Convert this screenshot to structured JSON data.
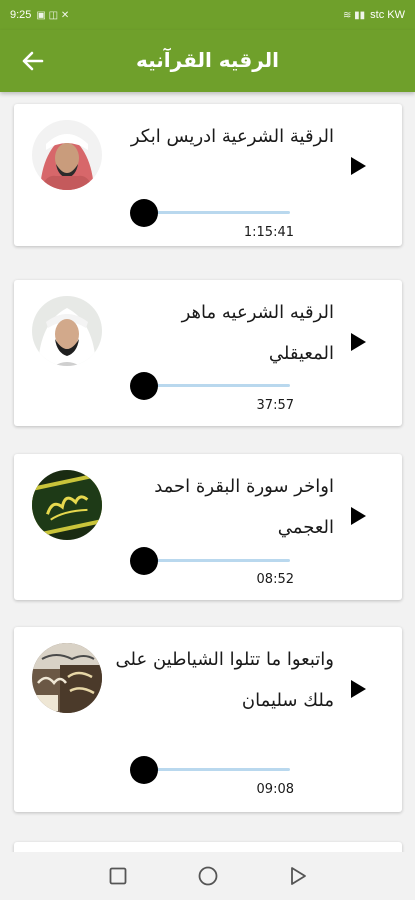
{
  "status_bar": {
    "time": "9:25",
    "left_glyphs": "▣ ◫ ✕",
    "right_glyphs": "≋ ▮▮",
    "carrier": "stc KW"
  },
  "app_bar": {
    "title": "الرقيه القرآنيه",
    "back_icon": "arrow-back-icon",
    "color": "#6fa02b"
  },
  "tracks": [
    {
      "title": "الرقية الشرعية ادريس ابكر",
      "duration": "1:15:41",
      "progress": 0,
      "avatar": "portrait-red-headscarf"
    },
    {
      "title": "الرقيه الشرعيه ماهر المعيقلي",
      "duration": "37:57",
      "progress": 0,
      "avatar": "portrait-white-headscarf"
    },
    {
      "title": "اواخر سورة البقرة احمد العجمي",
      "duration": "08:52",
      "progress": 0,
      "avatar": "calligraphy-cover-green"
    },
    {
      "title": "واتبعوا ما تتلوا الشياطين على ملك سليمان",
      "duration": "09:08",
      "progress": 0,
      "avatar": "calligraphy-cover-brown"
    }
  ],
  "nav_bar": {
    "recents_icon": "square-icon",
    "home_icon": "circle-icon",
    "back_icon": "triangle-back-icon"
  },
  "colors": {
    "accent": "#6fa02b",
    "slider_track": "#b9d8ee",
    "slider_thumb": "#000000"
  }
}
